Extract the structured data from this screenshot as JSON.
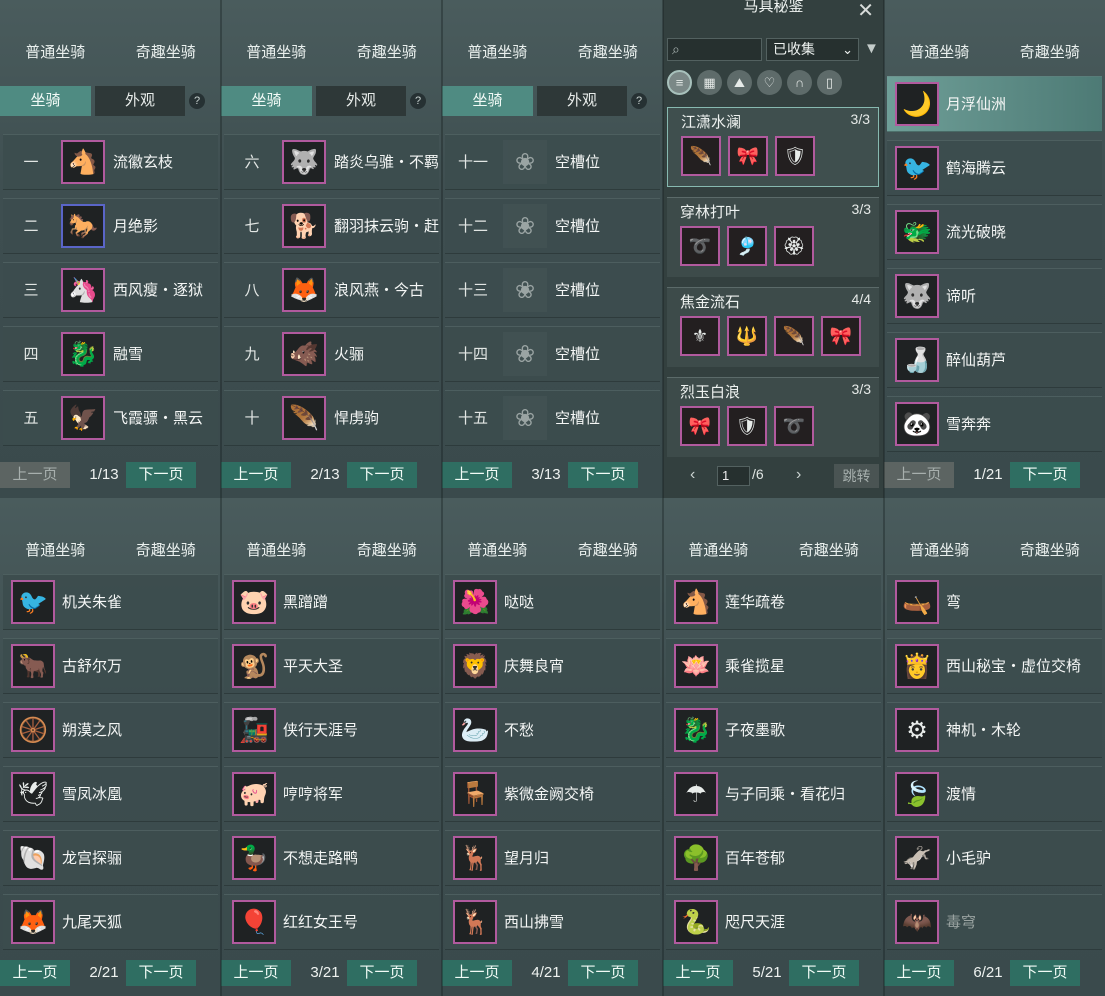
{
  "tabs": {
    "normal": "普通坐骑",
    "fun": "奇趣坐骑"
  },
  "subtabs": {
    "mount": "坐骑",
    "appearance": "外观",
    "help": "?"
  },
  "pager": {
    "prev": "上一页",
    "next": "下一页"
  },
  "panels_top": [
    {
      "page": "1/13",
      "prev_disabled": true,
      "rows": [
        {
          "num": "一",
          "name": "流徽玄枝"
        },
        {
          "num": "二",
          "name": "月绝影"
        },
        {
          "num": "三",
          "name": "西风瘦・逐狱"
        },
        {
          "num": "四",
          "name": "融雪"
        },
        {
          "num": "五",
          "name": "飞霞骠・黑云"
        }
      ]
    },
    {
      "page": "2/13",
      "prev_disabled": false,
      "rows": [
        {
          "num": "六",
          "name": "踏炎乌骓・不羁"
        },
        {
          "num": "七",
          "name": "翻羽抹云驹・赶"
        },
        {
          "num": "八",
          "name": "浪风燕・今古"
        },
        {
          "num": "九",
          "name": "火骊"
        },
        {
          "num": "十",
          "name": "悍虏驹"
        }
      ]
    },
    {
      "page": "3/13",
      "prev_disabled": false,
      "rows": [
        {
          "num": "十一",
          "name": "空槽位"
        },
        {
          "num": "十二",
          "name": "空槽位"
        },
        {
          "num": "十三",
          "name": "空槽位"
        },
        {
          "num": "十四",
          "name": "空槽位"
        },
        {
          "num": "十五",
          "name": "空槽位"
        }
      ]
    }
  ],
  "accessory": {
    "title": "马具秘鉴",
    "close": "✕",
    "search_placeholder": "",
    "filter_value": "已收集",
    "sets": [
      {
        "name": "江潇水澜",
        "count": "3/3",
        "n": 3
      },
      {
        "name": "穿林打叶",
        "count": "3/3",
        "n": 3
      },
      {
        "name": "焦金流石",
        "count": "4/4",
        "n": 4
      },
      {
        "name": "烈玉白浪",
        "count": "3/3",
        "n": 3
      }
    ],
    "page_input": "1",
    "page_total": "/6",
    "jump": "跳转"
  },
  "panel_fun_top": {
    "page": "1/21",
    "prev_disabled": true,
    "rows": [
      {
        "name": "月浮仙洲"
      },
      {
        "name": "鹤海腾云"
      },
      {
        "name": "流光破晓"
      },
      {
        "name": "谛听"
      },
      {
        "name": "醉仙葫芦"
      },
      {
        "name": "雪奔奔"
      }
    ]
  },
  "panels_bottom": [
    {
      "page": "2/21",
      "rows": [
        {
          "name": "机关朱雀"
        },
        {
          "name": "古舒尔万"
        },
        {
          "name": "朔漠之风"
        },
        {
          "name": "雪凤冰凰"
        },
        {
          "name": "龙宫探骊"
        },
        {
          "name": "九尾天狐"
        }
      ]
    },
    {
      "page": "3/21",
      "rows": [
        {
          "name": "黑蹭蹭"
        },
        {
          "name": "平天大圣"
        },
        {
          "name": "侠行天涯号"
        },
        {
          "name": "哼哼将军"
        },
        {
          "name": "不想走路鸭"
        },
        {
          "name": "红红女王号"
        }
      ]
    },
    {
      "page": "4/21",
      "rows": [
        {
          "name": "哒哒"
        },
        {
          "name": "庆舞良宵"
        },
        {
          "name": "不愁"
        },
        {
          "name": "紫微金阙交椅"
        },
        {
          "name": "望月归"
        },
        {
          "name": "西山拂雪"
        }
      ]
    },
    {
      "page": "5/21",
      "rows": [
        {
          "name": "莲华疏卷"
        },
        {
          "name": "乘雀揽星"
        },
        {
          "name": "子夜墨歌"
        },
        {
          "name": "与子同乘・看花归"
        },
        {
          "name": "百年苍郁"
        },
        {
          "name": "咫尺天涯"
        }
      ]
    },
    {
      "page": "6/21",
      "rows": [
        {
          "name": "弯"
        },
        {
          "name": "西山秘宝・虚位交椅"
        },
        {
          "name": "神机・木轮"
        },
        {
          "name": "渡情"
        },
        {
          "name": "小毛驴"
        },
        {
          "name": "毒穹"
        }
      ]
    }
  ]
}
